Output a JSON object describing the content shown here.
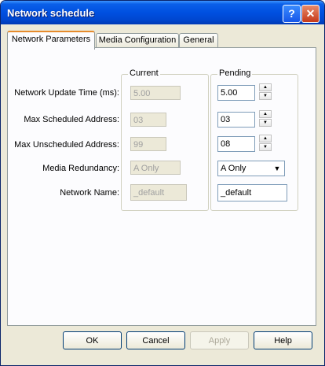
{
  "window": {
    "title": "Network schedule"
  },
  "tabs": [
    {
      "label": "Network Parameters",
      "active": true
    },
    {
      "label": "Media Configuration",
      "active": false
    },
    {
      "label": "General",
      "active": false
    }
  ],
  "groups": {
    "current": "Current",
    "pending": "Pending"
  },
  "rows": [
    {
      "label": "Network Update Time (ms):",
      "current": "5.00",
      "pending": "5.00"
    },
    {
      "label": "Max Scheduled Address:",
      "current": "03",
      "pending": "03"
    },
    {
      "label": "Max Unscheduled Address:",
      "current": "99",
      "pending": "08"
    },
    {
      "label": "Media Redundancy:",
      "current": "A Only",
      "pending": "A Only"
    },
    {
      "label": "Network Name:",
      "current": "_default",
      "pending": "_default"
    }
  ],
  "buttons": {
    "ok": "OK",
    "cancel": "Cancel",
    "apply": "Apply",
    "help": "Help"
  },
  "icons": {
    "help": "question-mark-icon",
    "close": "close-x-icon"
  }
}
